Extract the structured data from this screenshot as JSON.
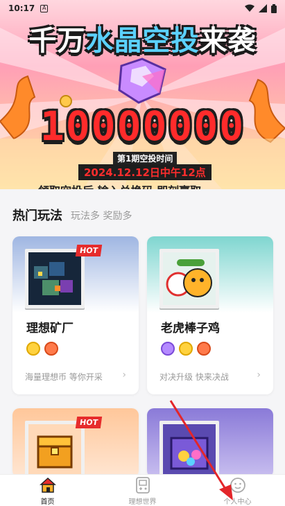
{
  "status_bar": {
    "time": "10:17",
    "app_badge": "A"
  },
  "banner": {
    "title_left": "千万",
    "title_accent": "水晶空投",
    "title_right": "来袭",
    "number": "10000000",
    "period_label": "第1期空投时间",
    "date": "2024.12.12日中午12点",
    "scroll_text": "领取空投后  输入兑换码 即刻赢取"
  },
  "section": {
    "title": "热门玩法",
    "subtitle": "玩法多 奖励多"
  },
  "cards": [
    {
      "name": "理想矿厂",
      "hot": "HOT",
      "footer": "海量理想币 等你开采",
      "chevron": "›"
    },
    {
      "name": "老虎棒子鸡",
      "hot": "",
      "footer": "对决升级 快来决战",
      "chevron": "›"
    },
    {
      "name": "",
      "hot": "HOT",
      "footer": "",
      "chevron": ""
    },
    {
      "name": "",
      "hot": "",
      "footer": "",
      "chevron": ""
    }
  ],
  "nav": [
    {
      "label": "首页",
      "icon": "home-icon",
      "active": true
    },
    {
      "label": "理想世界",
      "icon": "gamepad-icon",
      "active": false
    },
    {
      "label": "个人中心",
      "icon": "smiley-icon",
      "active": false
    }
  ],
  "colors": {
    "hot": "#e62c2c",
    "accent_red": "#ff2b2b",
    "arrow": "#e3262a"
  }
}
